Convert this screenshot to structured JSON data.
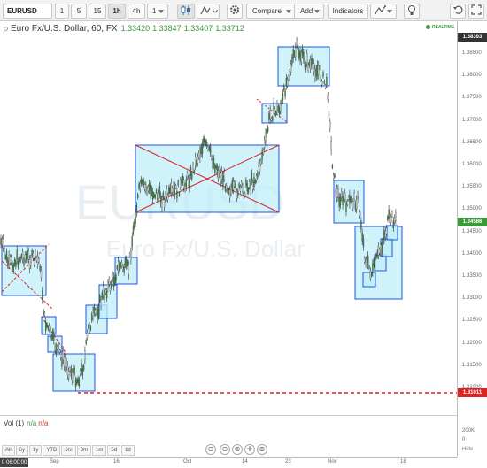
{
  "toolbar": {
    "symbol": "EURUSD",
    "intervals": [
      "1",
      "5",
      "15",
      "1h",
      "4h",
      "1"
    ],
    "compare": "Compare",
    "add": "Add",
    "indicators": "Indicators",
    "bar_style_icon": "candlestick-icon",
    "settings_icon": "gear-icon"
  },
  "legend": {
    "title": "Euro Fx/U.S. Dollar, 60, FX",
    "o": "1.33420",
    "h": "1.33847",
    "l": "1.33407",
    "c": "1.33712"
  },
  "realtime": "REALTIME",
  "watermark": {
    "symbol": "EURUSD",
    "name": "Euro Fx/U.S. Dollar"
  },
  "yaxis": {
    "ticks": [
      "1.38500",
      "1.38000",
      "1.37500",
      "1.37000",
      "1.36500",
      "1.36000",
      "1.35500",
      "1.35000",
      "1.34500",
      "1.34000",
      "1.33500",
      "1.33000",
      "1.32500",
      "1.32000",
      "1.31500",
      "1.31000"
    ]
  },
  "price_tags": {
    "top": "1.38393",
    "current": "1.34586",
    "line": "1.31011"
  },
  "volume": {
    "label": "Vol (1)",
    "v1": "n/a",
    "v2": "n/a",
    "ticks": [
      "200K",
      "0"
    ]
  },
  "ranges": [
    "All",
    "6y",
    "1y",
    "YTD",
    "6m",
    "3m",
    "1m",
    "5d",
    "1d"
  ],
  "zoom": [
    "⊖",
    "⊖",
    "⊕",
    "✛",
    "⊕"
  ],
  "hide": "Hide",
  "xaxis": {
    "first": "0 06:00:00",
    "labels": [
      "Sep",
      "16",
      "Oct",
      "14",
      "23",
      "Nov",
      "18"
    ]
  },
  "colors": {
    "up": "#3a9a3a",
    "box_fill": "#bfeefa",
    "box_stroke": "#2255dd",
    "red": "#dd2222",
    "price_line": "#333"
  }
}
